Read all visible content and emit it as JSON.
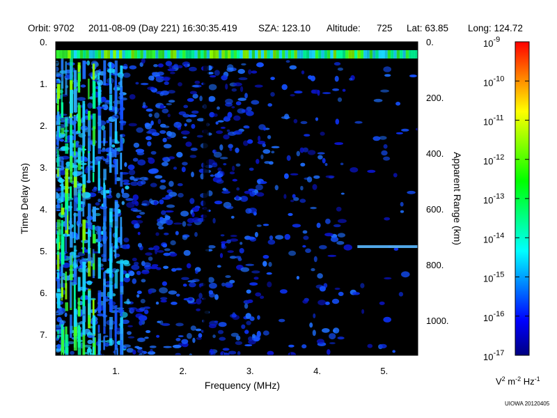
{
  "header": {
    "orbit": "Orbit: 9702",
    "datetime": "2011-08-09 (Day 221) 16:30:35.419",
    "sza": "SZA: 123.10",
    "altitude_label": "Altitude:",
    "altitude_value": "725",
    "lat": "Lat:  63.85",
    "long": "Long: 124.72"
  },
  "chart_data": {
    "type": "heatmap",
    "xlabel": "Frequency (MHz)",
    "ylabel": "Time Delay (ms)",
    "y2label": "Apparent Range (km)",
    "xlim": [
      0.1,
      5.5
    ],
    "ylim": [
      0,
      7.5
    ],
    "y2lim": [
      0,
      1125
    ],
    "x_ticks": [
      1,
      2,
      3,
      4,
      5
    ],
    "x_tick_labels": [
      "1.",
      "2.",
      "3.",
      "4.",
      "5."
    ],
    "y_ticks": [
      0,
      1,
      2,
      3,
      4,
      5,
      6,
      7
    ],
    "y_tick_labels": [
      "0.",
      "1.",
      "2.",
      "3.",
      "4.",
      "5.",
      "6.",
      "7."
    ],
    "y2_ticks": [
      0,
      200,
      400,
      600,
      800,
      1000
    ],
    "y2_tick_labels": [
      "0.",
      "200.",
      "400.",
      "600.",
      "800.",
      "1000."
    ],
    "colorbar": {
      "scale": "log",
      "range": [
        1e-17,
        1e-09
      ],
      "tick_exponents": [
        "-9",
        "-10",
        "-11",
        "-12",
        "-13",
        "-14",
        "-15",
        "-16",
        "-17"
      ],
      "tick_base": "10",
      "unit_parts": [
        "V",
        "2",
        " m",
        "-2",
        " Hz",
        "-1"
      ],
      "colors": [
        "#000080",
        "#0000ff",
        "#0080ff",
        "#00ffff",
        "#00ff80",
        "#00ff00",
        "#80ff00",
        "#ffff00",
        "#ff8000",
        "#ff0000"
      ]
    },
    "features": {
      "horizontal_band_at_ms": 4.9,
      "horizontal_band_from_mhz": 4.6,
      "top_band_ms": [
        0.2,
        0.4
      ]
    }
  },
  "footer": {
    "credit": "UIOWA 20120405"
  }
}
